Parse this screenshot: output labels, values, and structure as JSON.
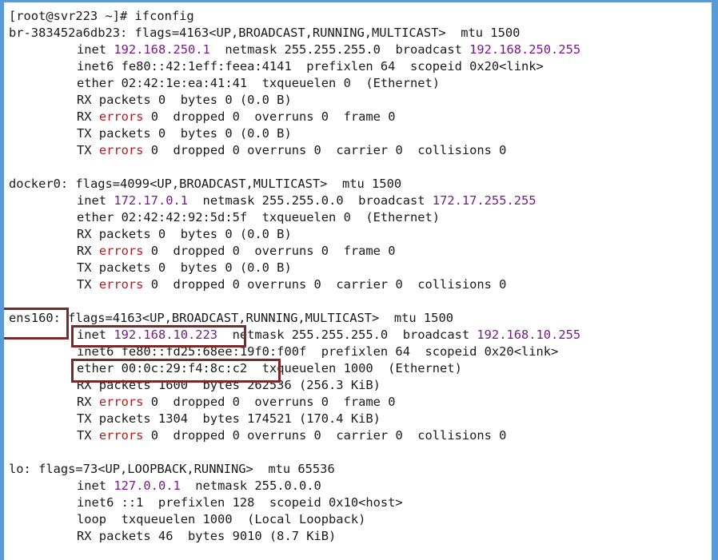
{
  "terminal": {
    "prompt": "[root@svr223 ~]# ",
    "command": "ifconfig",
    "accent_colors": {
      "number": "#7a1a8a",
      "error": "#b51a1a",
      "highlight_box": "#7b2a2a"
    }
  },
  "interfaces": [
    {
      "name": "br-383452a6db23",
      "flags": ": flags=4163<UP,BROADCAST,RUNNING,MULTICAST>  mtu 1500",
      "inet_ip": "192.168.250.1",
      "netmask_text": "  netmask 255.255.255.0  broadcast ",
      "broadcast": "192.168.250.255",
      "inet6": "inet6 fe80::42:1eff:feea:4141  prefixlen 64  scopeid 0x20<link>",
      "ether": "ether 02:42:1e:ea:41:41  txqueuelen 0  (Ethernet)",
      "rx_packets": "RX packets 0  bytes 0 (0.0 B)",
      "rx_errors": " 0  dropped 0  overruns 0  frame 0",
      "tx_packets": "TX packets 0  bytes 0 (0.0 B)",
      "tx_errors": " 0  dropped 0 overruns 0  carrier 0  collisions 0"
    },
    {
      "name": "docker0",
      "flags": ": flags=4099<UP,BROADCAST,MULTICAST>  mtu 1500",
      "inet_ip": "172.17.0.1",
      "netmask_text": "  netmask 255.255.0.0  broadcast ",
      "broadcast": "172.17.255.255",
      "ether": "ether 02:42:42:92:5d:5f  txqueuelen 0  (Ethernet)",
      "rx_packets": "RX packets 0  bytes 0 (0.0 B)",
      "rx_errors": " 0  dropped 0  overruns 0  frame 0",
      "tx_packets": "TX packets 0  bytes 0 (0.0 B)",
      "tx_errors": " 0  dropped 0 overruns 0  carrier 0  collisions 0"
    },
    {
      "name": "ens160",
      "flags": ": flags=4163<UP,BROADCAST,RUNNING,MULTICAST>  mtu 1500",
      "inet_ip": "192.168.10.223",
      "netmask_text": "  netmask 255.255.255.0  broadcast ",
      "broadcast": "192.168.10.255",
      "inet6": "inet6 fe80::fd25:68ee:19f0:f00f  prefixlen 64  scopeid 0x20<link>",
      "ether_mac": "ether 00:0c:29:f4:8c:c2",
      "ether_rest": "  txqueuelen 1000  (Ethernet)",
      "rx_packets": "RX packets 1600  bytes 262536 (256.3 KiB)",
      "rx_errors": " 0  dropped 0  overruns 0  frame 0",
      "tx_packets": "TX packets 1304  bytes 174521 (170.4 KiB)",
      "tx_errors": " 0  dropped 0 overruns 0  carrier 0  collisions 0"
    },
    {
      "name": "lo",
      "flags": ": flags=73<UP,LOOPBACK,RUNNING>  mtu 65536",
      "inet_ip": "127.0.0.1",
      "netmask_text": "  netmask 255.0.0.0",
      "inet6": "inet6 ::1  prefixlen 128  scopeid 0x10<host>",
      "loop": "loop  txqueuelen 1000  (Local Loopback)",
      "rx_packets": "RX packets 46  bytes 9010 (8.7 KiB)"
    }
  ],
  "labels": {
    "inet": "inet ",
    "rx": "RX ",
    "tx": "TX ",
    "errors": "errors"
  }
}
